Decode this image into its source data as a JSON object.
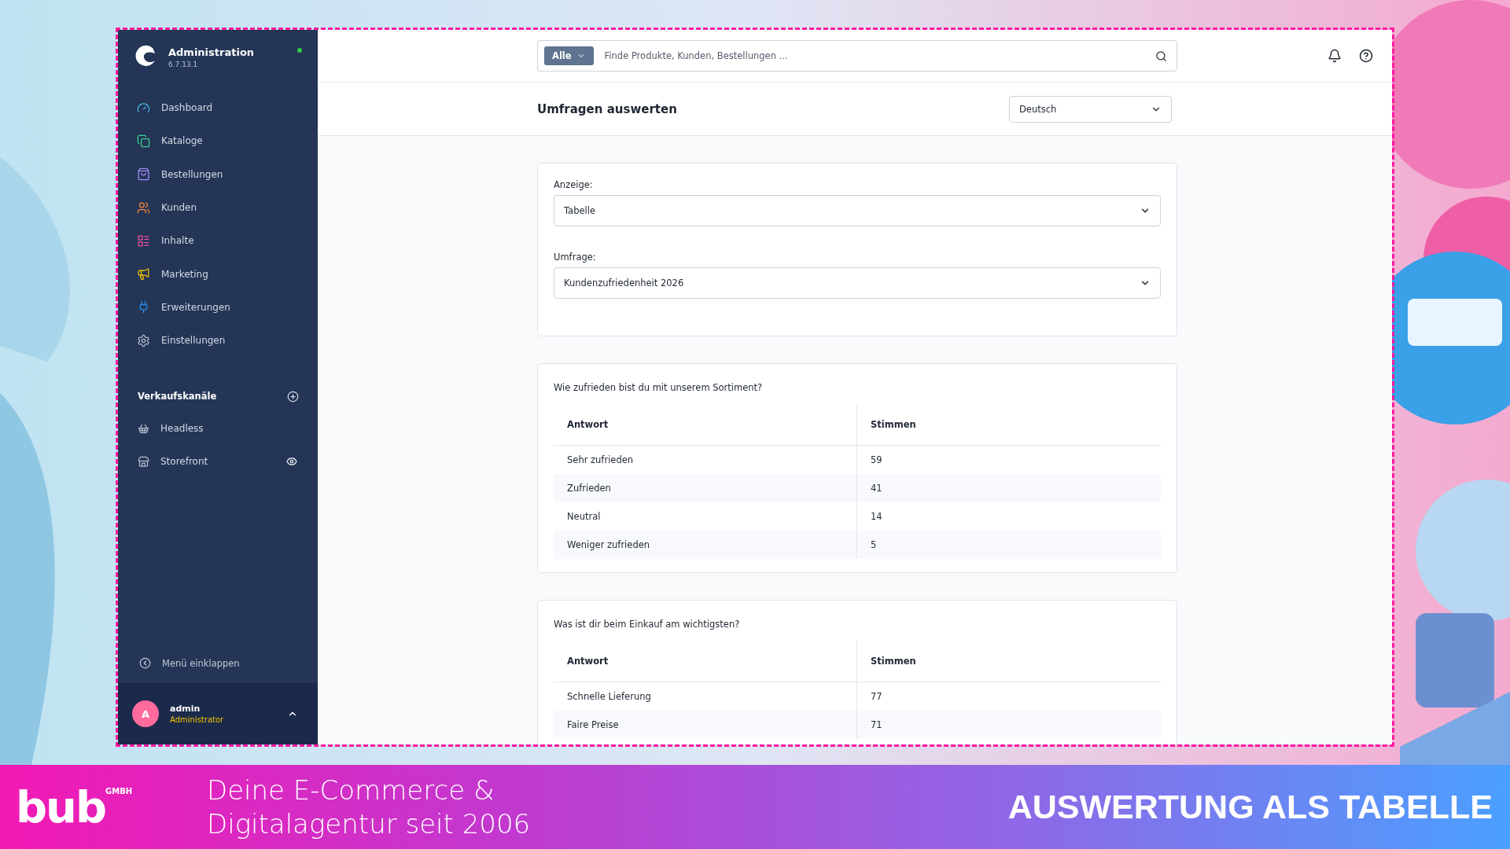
{
  "sidebar": {
    "title": "Administration",
    "version": "6.7.13.1",
    "items": [
      {
        "label": "Dashboard"
      },
      {
        "label": "Kataloge"
      },
      {
        "label": "Bestellungen"
      },
      {
        "label": "Kunden"
      },
      {
        "label": "Inhalte"
      },
      {
        "label": "Marketing"
      },
      {
        "label": "Erweiterungen"
      },
      {
        "label": "Einstellungen"
      }
    ],
    "sales_channels": {
      "heading": "Verkaufskanäle",
      "items": [
        {
          "label": "Headless",
          "visible_toggle": false
        },
        {
          "label": "Storefront",
          "visible_toggle": true
        }
      ]
    },
    "collapse": "Menü einklappen",
    "user": {
      "initial": "A",
      "name": "admin",
      "role": "Administrator"
    }
  },
  "topbar": {
    "scope": "Alle",
    "placeholder": "Finde Produkte, Kunden, Bestellungen ..."
  },
  "header": {
    "title": "Umfragen auswerten",
    "language": "Deutsch"
  },
  "filters": [
    {
      "label": "Anzeige:",
      "value": "Tabelle"
    },
    {
      "label": "Umfrage:",
      "value": "Kundenzufriedenheit 2026"
    }
  ],
  "surveys": [
    {
      "question": "Wie zufrieden bist du mit unserem Sortiment?",
      "columns": [
        "Antwort",
        "Stimmen"
      ],
      "rows": [
        [
          "Sehr zufrieden",
          "59"
        ],
        [
          "Zufrieden",
          "41"
        ],
        [
          "Neutral",
          "14"
        ],
        [
          "Weniger zufrieden",
          "5"
        ]
      ]
    },
    {
      "question": "Was ist dir beim Einkauf am wichtigsten?",
      "columns": [
        "Antwort",
        "Stimmen"
      ],
      "rows": [
        [
          "Schnelle Lieferung",
          "77"
        ],
        [
          "Faire Preise",
          "71"
        ]
      ]
    }
  ],
  "banner": {
    "logo": "bub",
    "logo_suffix": "GMBH",
    "tagline": [
      "Deine E-Commerce &",
      "Digitalagentur seit 2006"
    ],
    "headline": "AUSWERTUNG ALS TABELLE"
  }
}
